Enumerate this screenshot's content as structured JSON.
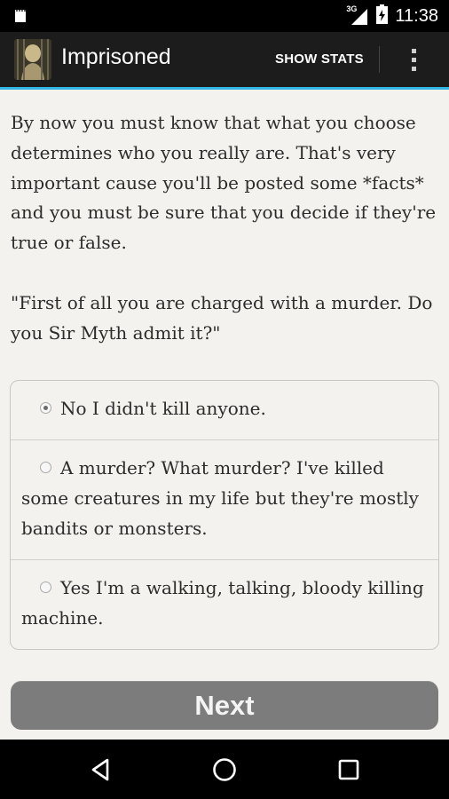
{
  "status_bar": {
    "time": "11:38",
    "network_label": "3G",
    "icons": [
      "notification-icon",
      "signal-icon",
      "battery-icon"
    ]
  },
  "action_bar": {
    "title": "Imprisoned",
    "show_stats_label": "SHOW STATS",
    "accent_color": "#33b5e5"
  },
  "story": {
    "paragraphs": [
      "By now you must know that what you choose determines who you really are. That's very important cause you'll be posted some *facts* and you must be sure that you decide if they're true or false.",
      "\"First of all you are charged with a murder. Do you Sir Myth admit it?\""
    ]
  },
  "choices": [
    {
      "text": "No I didn't kill anyone.",
      "selected": true
    },
    {
      "text": "A murder? What murder? I've killed some creatures in my life but they're mostly bandits or monsters.",
      "selected": false
    },
    {
      "text": "Yes I'm a walking, talking, bloody killing machine.",
      "selected": false
    }
  ],
  "next_button": {
    "label": "Next"
  },
  "nav_bar": {
    "buttons": [
      "back-icon",
      "home-icon",
      "recents-icon"
    ]
  }
}
